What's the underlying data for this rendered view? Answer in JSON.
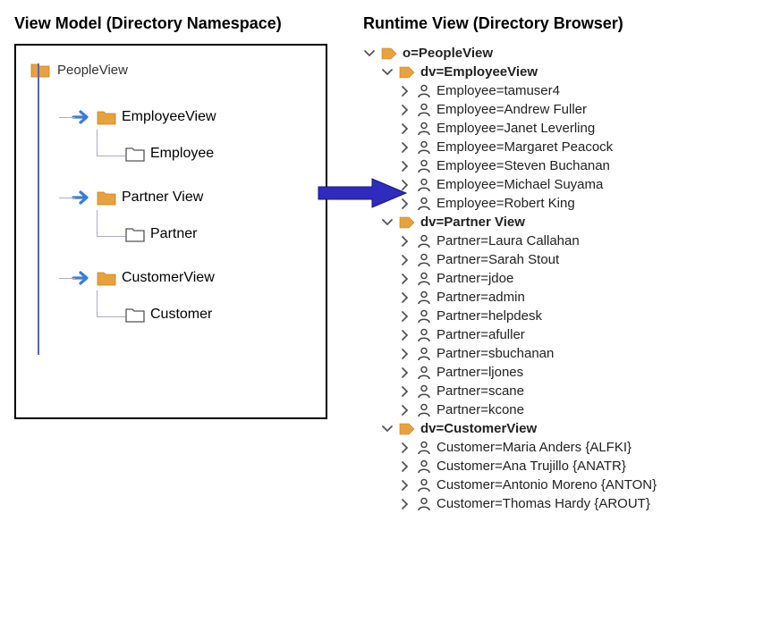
{
  "left": {
    "title": "View Model (Directory Namespace)",
    "root": "PeopleView",
    "subviews": [
      {
        "name": "EmployeeView",
        "leaf": "Employee"
      },
      {
        "name": "Partner View",
        "leaf": "Partner"
      },
      {
        "name": "CustomerView",
        "leaf": "Customer"
      }
    ]
  },
  "right": {
    "title": "Runtime View (Directory Browser)",
    "root": "o=PeopleView",
    "branches": [
      {
        "label": "dv=EmployeeView",
        "items": [
          "Employee=tamuser4",
          "Employee=Andrew Fuller",
          "Employee=Janet Leverling",
          "Employee=Margaret Peacock",
          "Employee=Steven Buchanan",
          "Employee=Michael Suyama",
          "Employee=Robert King"
        ]
      },
      {
        "label": "dv=Partner View",
        "items": [
          "Partner=Laura Callahan",
          "Partner=Sarah Stout",
          "Partner=jdoe",
          "Partner=admin",
          "Partner=helpdesk",
          "Partner=afuller",
          "Partner=sbuchanan",
          "Partner=ljones",
          "Partner=scane",
          "Partner=kcone"
        ]
      },
      {
        "label": "dv=CustomerView",
        "items": [
          "Customer=Maria Anders {ALFKI}",
          "Customer=Ana Trujillo {ANATR}",
          "Customer=Antonio Moreno {ANTON}",
          "Customer=Thomas Hardy {AROUT}"
        ]
      }
    ]
  }
}
